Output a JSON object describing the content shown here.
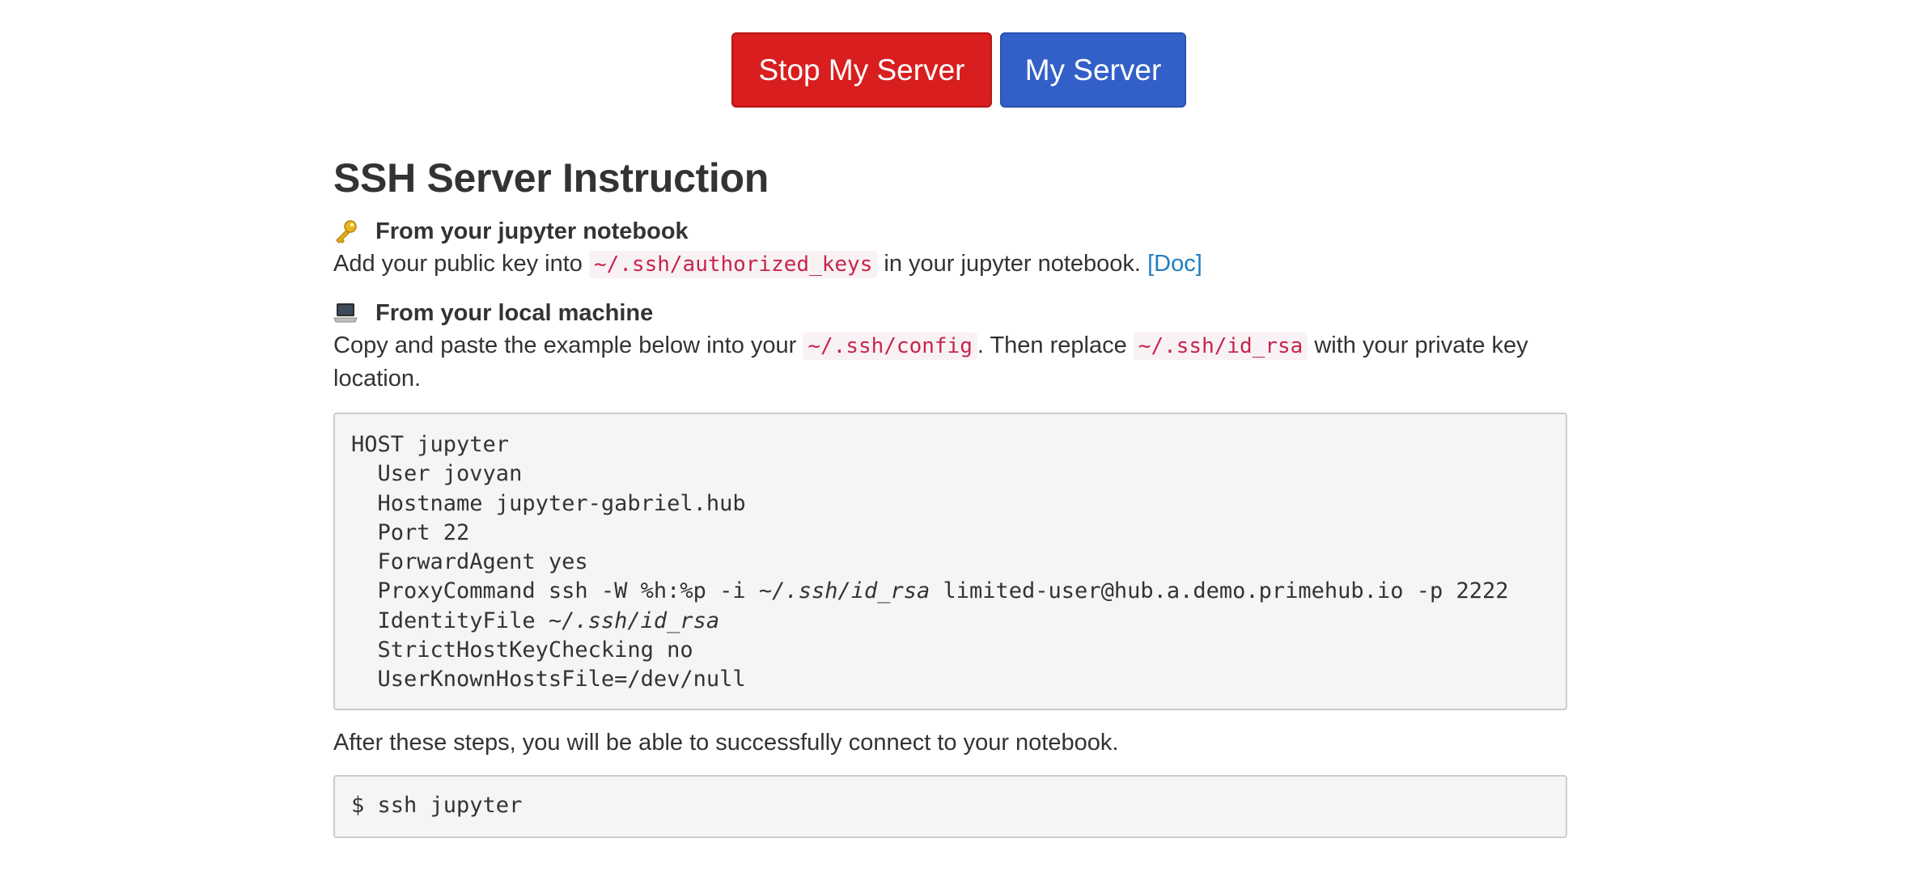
{
  "buttons": {
    "stop_label": "Stop My Server",
    "server_label": "My Server"
  },
  "colors": {
    "stop_button": "#d81e1e",
    "server_button": "#3360c8",
    "code_text": "#c7254e",
    "link": "#1f7ec2"
  },
  "instructions": {
    "title": "SSH Server Instruction",
    "jupyter_section": {
      "icon": "key-icon",
      "heading": "From your jupyter notebook",
      "text_before": "Add your public key into",
      "code": "~/.ssh/authorized_keys",
      "text_after": "in your jupyter notebook.",
      "doc_link": "[Doc]"
    },
    "local_section": {
      "icon": "laptop-icon",
      "heading": "From your local machine",
      "text_1": "Copy and paste the example below into your",
      "code_1": "~/.ssh/config",
      "text_2": ". Then replace",
      "code_2": "~/.ssh/id_rsa",
      "text_3": "with your private key location."
    },
    "config_block": {
      "line_1": "HOST jupyter",
      "line_2": "  User jovyan",
      "line_3": "  Hostname jupyter-gabriel.hub",
      "line_4": "  Port 22",
      "line_5": "  ForwardAgent yes",
      "line_6_a": "  ProxyCommand ssh -W %h:%p -i ",
      "line_6_path": "~/.ssh/id_rsa",
      "line_6_b": " limited-user@hub.a.demo.primehub.io -p 2222",
      "line_7_a": "  IdentityFile ",
      "line_7_path": "~/.ssh/id_rsa",
      "line_8": "  StrictHostKeyChecking no",
      "line_9": "  UserKnownHostsFile=/dev/null"
    },
    "after_text": "After these steps, you will be able to successfully connect to your notebook.",
    "command_block": "$ ssh jupyter"
  }
}
